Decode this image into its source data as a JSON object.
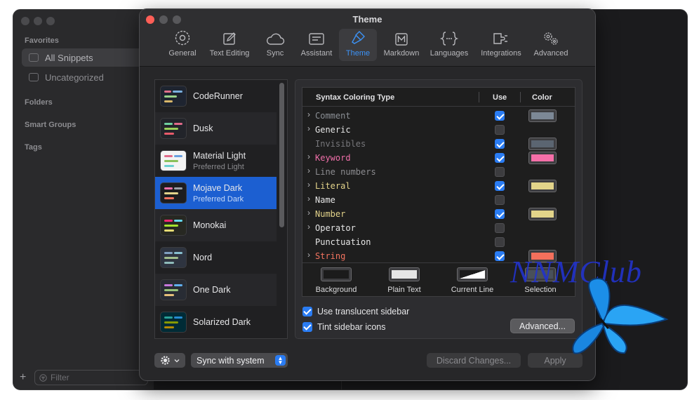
{
  "window": {
    "title": "Theme"
  },
  "background_window": {
    "sections": {
      "favorites": "Favorites",
      "folders": "Folders",
      "smart_groups": "Smart Groups",
      "tags": "Tags"
    },
    "items": {
      "all_snippets": "All Snippets",
      "uncategorized": "Uncategorized"
    },
    "filter_placeholder": "Filter",
    "add_label": "+"
  },
  "toolbar": {
    "general": "General",
    "text_editing": "Text Editing",
    "sync": "Sync",
    "assistant": "Assistant",
    "theme": "Theme",
    "markdown": "Markdown",
    "languages": "Languages",
    "integrations": "Integrations",
    "advanced": "Advanced",
    "selected": "theme"
  },
  "themes": [
    {
      "name": "CodeRunner",
      "sub": ""
    },
    {
      "name": "Dusk",
      "sub": ""
    },
    {
      "name": "Material Light",
      "sub": "Preferred Light"
    },
    {
      "name": "Mojave Dark",
      "sub": "Preferred Dark",
      "selected": true
    },
    {
      "name": "Monokai",
      "sub": ""
    },
    {
      "name": "Nord",
      "sub": ""
    },
    {
      "name": "One Dark",
      "sub": ""
    },
    {
      "name": "Solarized Dark",
      "sub": ""
    }
  ],
  "syntax_table": {
    "col_type": "Syntax Coloring Type",
    "col_use": "Use",
    "col_color": "Color",
    "rows": [
      {
        "name": "Comment",
        "expandable": true,
        "use": true,
        "text_color": "#8b8f95",
        "swatch": "#7c8896"
      },
      {
        "name": "Generic",
        "expandable": true,
        "use": false,
        "text_color": "#e6e6e6",
        "swatch": null
      },
      {
        "name": "Invisibles",
        "expandable": false,
        "use": true,
        "text_color": "#77777b",
        "swatch": "#5b6571"
      },
      {
        "name": "Keyword",
        "expandable": true,
        "use": true,
        "text_color": "#f06fa9",
        "swatch": "#f56fa8"
      },
      {
        "name": "Line numbers",
        "expandable": true,
        "use": false,
        "text_color": "#8c8c90",
        "swatch": null
      },
      {
        "name": "Literal",
        "expandable": true,
        "use": true,
        "text_color": "#e3d38a",
        "swatch": "#e2d48a"
      },
      {
        "name": "Name",
        "expandable": true,
        "use": false,
        "text_color": "#e6e6e6",
        "swatch": null
      },
      {
        "name": "Number",
        "expandable": true,
        "use": true,
        "text_color": "#e3d38a",
        "swatch": "#e2d48a"
      },
      {
        "name": "Operator",
        "expandable": true,
        "use": false,
        "text_color": "#e6e6e6",
        "swatch": null
      },
      {
        "name": "Punctuation",
        "expandable": false,
        "use": false,
        "text_color": "#e6e6e6",
        "swatch": null
      },
      {
        "name": "String",
        "expandable": true,
        "use": true,
        "text_color": "#f2735f",
        "swatch": "#f4705c"
      }
    ],
    "bottom": [
      {
        "label": "Background"
      },
      {
        "label": "Plain Text"
      },
      {
        "label": "Current Line"
      },
      {
        "label": "Selection"
      }
    ]
  },
  "options": {
    "translucent_sidebar": "Use translucent sidebar",
    "tint_icons": "Tint sidebar icons",
    "advanced_button": "Advanced..."
  },
  "footer": {
    "appearance_mode": "Sync with system",
    "discard": "Discard Changes...",
    "apply": "Apply"
  },
  "watermark": "NNMClub",
  "colors": {
    "accent": "#2a7cf3",
    "selection": "#1c5fd1"
  }
}
